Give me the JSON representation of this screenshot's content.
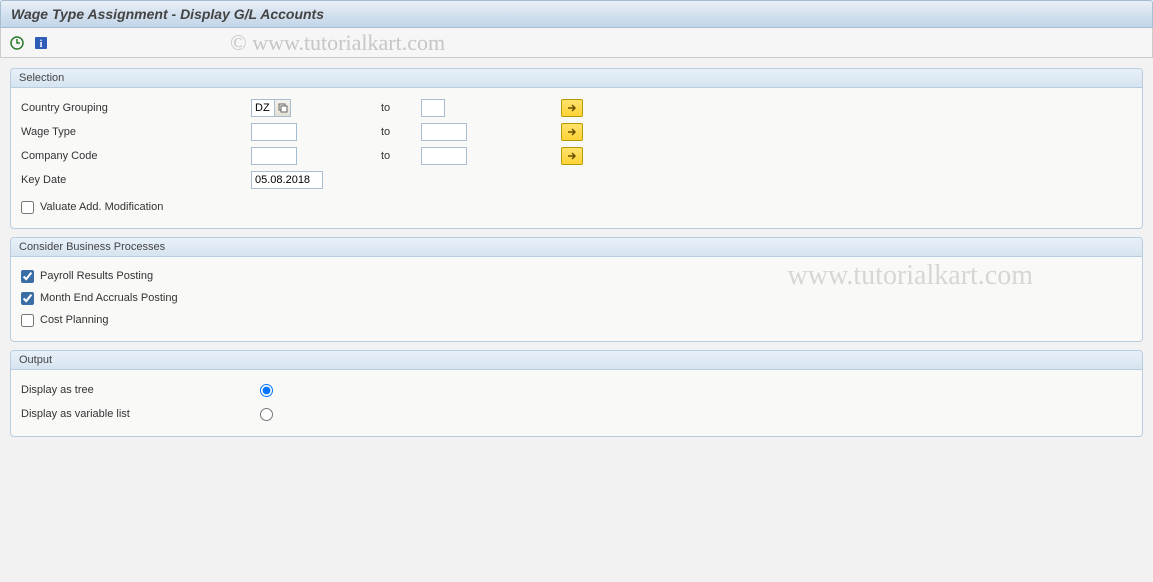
{
  "header": {
    "title": "Wage Type Assignment - Display G/L Accounts"
  },
  "watermark": {
    "text1": "© www.tutorialkart.com",
    "text2": "www.tutorialkart.com"
  },
  "selection": {
    "title": "Selection",
    "rows": {
      "country": {
        "label": "Country Grouping",
        "from": "DZ",
        "to_label": "to",
        "to": ""
      },
      "wagetype": {
        "label": "Wage Type",
        "from": "",
        "to_label": "to",
        "to": ""
      },
      "company": {
        "label": "Company Code",
        "from": "",
        "to_label": "to",
        "to": ""
      },
      "keydate": {
        "label": "Key Date",
        "value": "05.08.2018"
      },
      "valuate": {
        "label": "Valuate Add. Modification",
        "checked": false
      }
    }
  },
  "processes": {
    "title": "Consider Business Processes",
    "payroll": {
      "label": "Payroll Results Posting",
      "checked": true
    },
    "monthend": {
      "label": "Month End Accruals Posting",
      "checked": true
    },
    "costplan": {
      "label": "Cost Planning",
      "checked": false
    }
  },
  "output": {
    "title": "Output",
    "tree": {
      "label": "Display as tree"
    },
    "list": {
      "label": "Display as variable list"
    },
    "selected": "tree"
  }
}
